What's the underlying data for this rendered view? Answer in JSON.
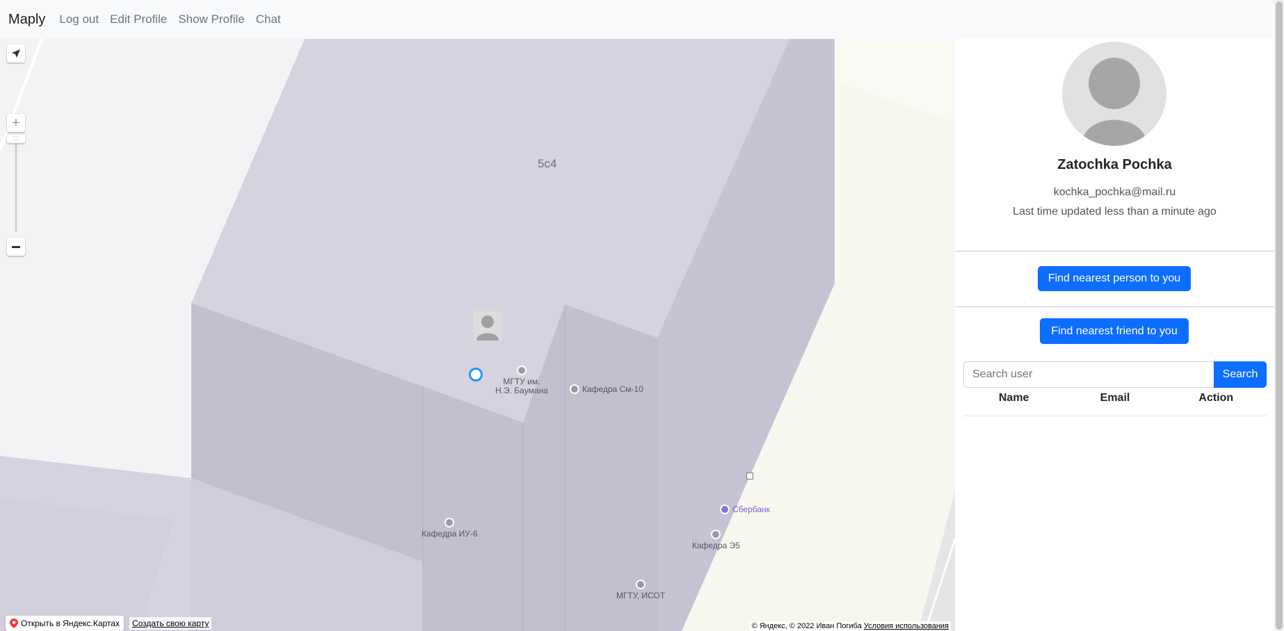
{
  "navbar": {
    "brand": "Maply",
    "links": [
      "Log out",
      "Edit Profile",
      "Show Profile",
      "Chat"
    ]
  },
  "map": {
    "building_number": "5с4",
    "pois": [
      {
        "name": "МГТУ им.\nН.Э. Баумана",
        "icon": "education-icon"
      },
      {
        "name": "Кафедра См-10",
        "icon": "education-icon"
      },
      {
        "name": "Кафедра ИУ-6",
        "icon": "education-icon"
      },
      {
        "name": "Сбербанк",
        "icon": "bank-ruble-icon"
      },
      {
        "name": "Кафедра Э5",
        "icon": "education-icon"
      },
      {
        "name": "МГТУ, ИСОТ",
        "icon": "education-icon"
      }
    ],
    "open_in_yandex": "Открыть в Яндекс.Картах",
    "create_map": "Создать свою карту",
    "copyright": "© Яндекс, © 2022 Иван Погиба",
    "terms": "Условия использования"
  },
  "profile": {
    "name": "Zatochka Pochka",
    "email": "kochka_pochka@mail.ru",
    "updated": "Last time updated less than a minute ago"
  },
  "actions": {
    "find_person": "Find nearest person to you",
    "find_friend": "Find nearest friend to you"
  },
  "search": {
    "placeholder": "Search user",
    "button": "Search"
  },
  "table": {
    "headers": [
      "Name",
      "Email",
      "Action"
    ]
  },
  "colors": {
    "accent": "#0d6efd",
    "navbar_bg": "#f8f9fa",
    "building": "#d6d3e0",
    "geo_marker": "#1e98ff"
  }
}
